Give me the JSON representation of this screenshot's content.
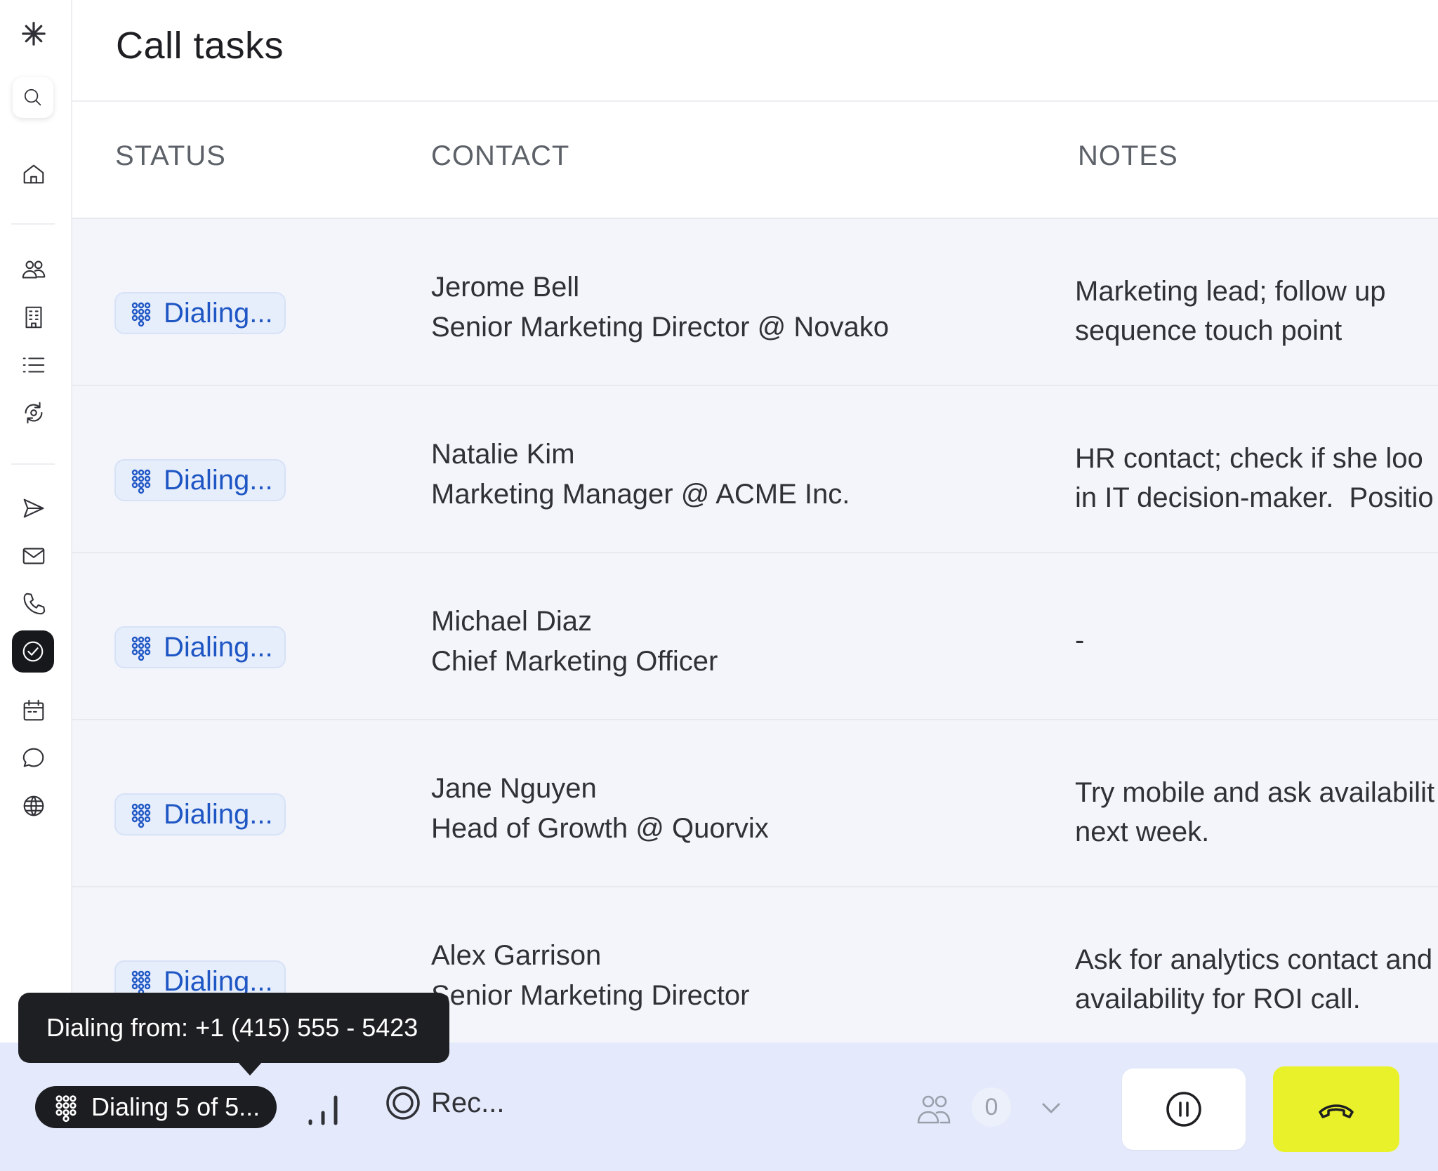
{
  "app": {
    "logo_icon": "asterisk-logo-icon"
  },
  "header": {
    "title": "Call tasks"
  },
  "columns": {
    "status": "STATUS",
    "contact": "CONTACT",
    "notes": "NOTES"
  },
  "sidebar": {
    "items": [
      {
        "icon": "search-icon"
      },
      {
        "icon": "home-icon"
      },
      {
        "icon": "people-icon"
      },
      {
        "icon": "building-icon"
      },
      {
        "icon": "list-icon"
      },
      {
        "icon": "sync-target-icon"
      },
      {
        "icon": "send-icon"
      },
      {
        "icon": "mail-icon"
      },
      {
        "icon": "phone-icon"
      },
      {
        "icon": "check-circle-icon",
        "active": true
      },
      {
        "icon": "calendar-icon"
      },
      {
        "icon": "chat-icon"
      },
      {
        "icon": "globe-icon"
      }
    ]
  },
  "rows": [
    {
      "status": "Dialing...",
      "name": "Jerome Bell",
      "title": "Senior Marketing Director @ Novako",
      "notes": "Marketing lead; follow up\nsequence touch point"
    },
    {
      "status": "Dialing...",
      "name": "Natalie Kim",
      "title": "Marketing Manager @ ACME Inc.",
      "notes": "HR contact; check if she loo\nin IT decision-maker.  Positio"
    },
    {
      "status": "Dialing...",
      "name": "Michael Diaz",
      "title": "Chief Marketing Officer",
      "notes": "-"
    },
    {
      "status": "Dialing...",
      "name": "Jane Nguyen",
      "title": "Head of Growth @ Quorvix",
      "notes": "Try mobile and ask availabilit\nnext week."
    },
    {
      "status": "Dialing...",
      "name": "Alex Garrison",
      "title": "Senior Marketing Director",
      "notes": "Ask for analytics contact and\navailability for ROI call."
    }
  ],
  "tooltip": {
    "text": "Dialing from: +1 (415) 555 - 5423"
  },
  "bottombar": {
    "dialing_label": "Dialing 5 of 5...",
    "record_label": "Rec...",
    "participants_count": "0",
    "accent": "#e8f12a"
  }
}
